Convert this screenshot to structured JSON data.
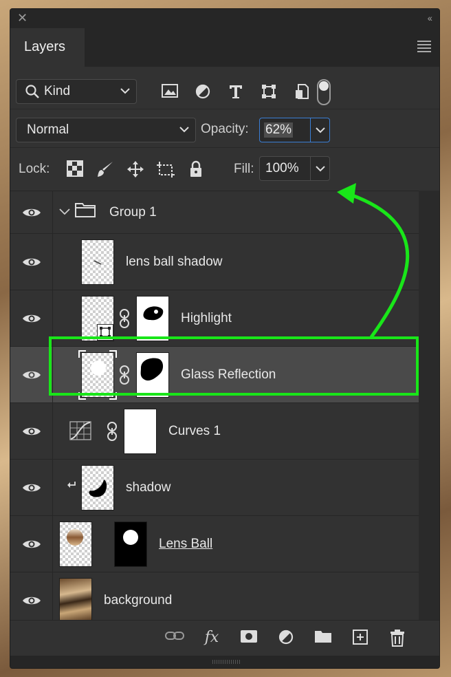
{
  "window": {
    "close_glyph": "✕",
    "collapse_glyph": "‹‹"
  },
  "tabs": [
    {
      "label": "Layers"
    }
  ],
  "filter": {
    "kind_label": "Kind",
    "icons": [
      "image-filter-icon",
      "adjustment-filter-icon",
      "type-filter-icon",
      "shape-filter-icon",
      "smart-object-filter-icon"
    ],
    "toggle_on": true
  },
  "blend": {
    "mode": "Normal",
    "opacity_label": "Opacity:",
    "opacity_value": "62%"
  },
  "lock": {
    "label": "Lock:",
    "fill_label": "Fill:",
    "fill_value": "100%",
    "icons": [
      "lock-transparent-pixels-icon",
      "lock-image-pixels-icon",
      "lock-position-icon",
      "lock-artboard-icon",
      "lock-all-icon"
    ]
  },
  "layers": [
    {
      "name": "Group 1",
      "type": "group",
      "visible": true
    },
    {
      "name": "lens ball shadow",
      "type": "pixel",
      "visible": true
    },
    {
      "name": "Highlight",
      "type": "smart-with-mask",
      "visible": true
    },
    {
      "name": "Glass Reflection",
      "type": "pixel-with-mask",
      "visible": true,
      "selected": true
    },
    {
      "name": "Curves 1",
      "type": "adjustment",
      "visible": true
    },
    {
      "name": "shadow",
      "type": "clipped",
      "visible": true
    },
    {
      "name": "Lens Ball",
      "type": "pixel-with-mask",
      "visible": true,
      "underlined": true
    },
    {
      "name": "background",
      "type": "image",
      "visible": true
    }
  ],
  "footer": {
    "fx_label": "fx",
    "icons": [
      "link-layers-icon",
      "layer-style-icon",
      "add-mask-icon",
      "new-adjustment-icon",
      "new-group-icon",
      "new-layer-icon",
      "delete-layer-icon"
    ]
  },
  "colors": {
    "panel": "#323232",
    "selected": "#4a4a4a",
    "annotation": "#19e619",
    "focus": "#3b7fd6"
  }
}
